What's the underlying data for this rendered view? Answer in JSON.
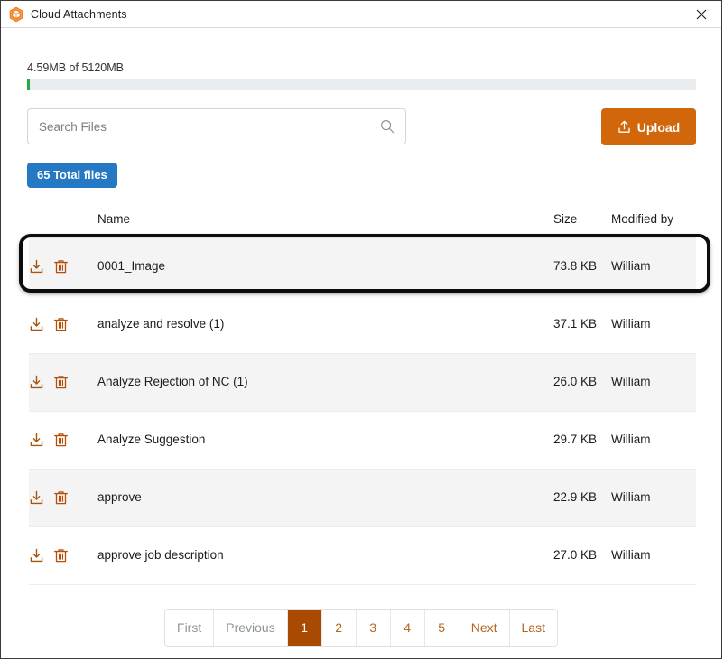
{
  "window": {
    "title": "Cloud Attachments",
    "app_icon": "cube-hexagon-icon",
    "close_label": "✕"
  },
  "quota": {
    "label": "4.59MB of 5120MB",
    "used_mb": 4.59,
    "total_mb": 5120,
    "percent": 0.09,
    "fill_color": "#2aa83f",
    "track_color": "#e8ecee"
  },
  "search": {
    "placeholder": "Search Files",
    "value": "",
    "icon": "search-icon"
  },
  "upload": {
    "label": "Upload",
    "icon": "upload-icon",
    "color": "#d2660a"
  },
  "total_badge": {
    "label": "65 Total files",
    "color": "#2578c4"
  },
  "table": {
    "headers": {
      "actions": "",
      "name": "Name",
      "size": "Size",
      "modified_by": "Modified by"
    },
    "download_icon": "download-icon",
    "delete_icon": "trash-icon",
    "rows": [
      {
        "name": "0001_Image",
        "size": "73.8 KB",
        "modified_by": "William",
        "selected": true,
        "striped": false
      },
      {
        "name": "analyze and resolve (1)",
        "size": "37.1 KB",
        "modified_by": "William",
        "selected": false,
        "striped": false
      },
      {
        "name": "Analyze Rejection of NC (1)",
        "size": "26.0 KB",
        "modified_by": "William",
        "selected": false,
        "striped": true
      },
      {
        "name": "Analyze Suggestion",
        "size": "29.7 KB",
        "modified_by": "William",
        "selected": false,
        "striped": false
      },
      {
        "name": "approve",
        "size": "22.9 KB",
        "modified_by": "William",
        "selected": false,
        "striped": true
      },
      {
        "name": "approve job description",
        "size": "27.0 KB",
        "modified_by": "William",
        "selected": false,
        "striped": false
      }
    ]
  },
  "pagination": {
    "current_page": 1,
    "items": [
      {
        "label": "First",
        "state": "muted"
      },
      {
        "label": "Previous",
        "state": "muted"
      },
      {
        "label": "1",
        "state": "active"
      },
      {
        "label": "2",
        "state": "num"
      },
      {
        "label": "3",
        "state": "num"
      },
      {
        "label": "4",
        "state": "num"
      },
      {
        "label": "5",
        "state": "num"
      },
      {
        "label": "Next",
        "state": "link"
      },
      {
        "label": "Last",
        "state": "link"
      }
    ],
    "active_color": "#a84a02",
    "link_color": "#b5651d"
  }
}
